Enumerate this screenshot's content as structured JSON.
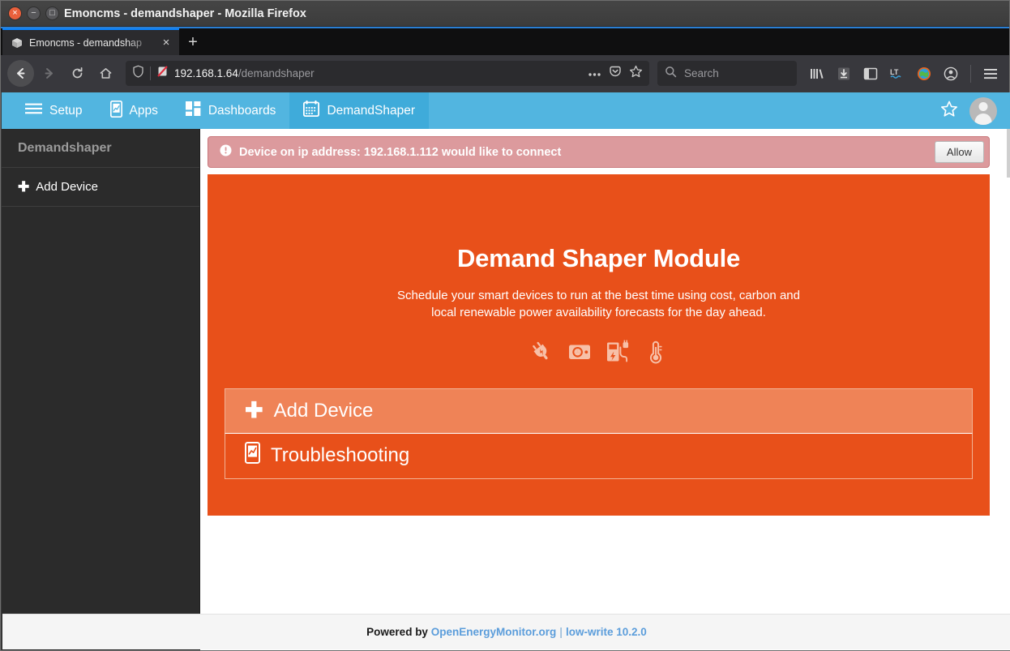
{
  "window": {
    "title": "Emoncms - demandshaper - Mozilla Firefox",
    "close_glyph": "×",
    "minimize_glyph": "−",
    "maximize_glyph": "□"
  },
  "browser": {
    "tab": {
      "title": "Emoncms - demandshap",
      "close_glyph": "×",
      "favicon_name": "box-favicon"
    },
    "new_tab_glyph": "+",
    "back_glyph": "←",
    "forward_glyph": "→",
    "reload_glyph": "↻",
    "home_glyph": "⌂",
    "url": {
      "host": "192.168.1.64",
      "path": "/demandshaper"
    },
    "search": {
      "placeholder": "Search"
    },
    "toolbar_icons": [
      "library-icon",
      "downloads-icon",
      "sidebar-icon",
      "languagetool-icon",
      "globe-extension-icon",
      "account-icon",
      "app-menu-icon"
    ]
  },
  "topnav": {
    "items": [
      {
        "label": "Setup",
        "icon": "hamburger-icon",
        "active": false
      },
      {
        "label": "Apps",
        "icon": "mobile-chart-icon",
        "active": false
      },
      {
        "label": "Dashboards",
        "icon": "grid-icon",
        "active": false
      },
      {
        "label": "DemandShaper",
        "icon": "calendar-icon",
        "active": true
      }
    ],
    "star_glyph": "☆",
    "avatar_name": "user-avatar"
  },
  "sidebar": {
    "header": "Demandshaper",
    "items": [
      {
        "label": "Add Device",
        "icon": "plus-icon",
        "plus": "✚"
      }
    ]
  },
  "alert": {
    "icon": "exclamation-circle-icon",
    "message": "Device on ip address: 192.168.1.112 would like to connect",
    "button_label": "Allow"
  },
  "hero": {
    "title": "Demand Shaper Module",
    "subtitle": "Schedule your smart devices to run at the best time using cost, carbon and local renewable power availability forecasts for the day ahead.",
    "device_icons": [
      "plug-icon",
      "washing-machine-icon",
      "ev-charger-icon",
      "thermostat-icon"
    ],
    "actions": [
      {
        "label": "Add Device",
        "icon": "plus-icon",
        "plus": "✚",
        "hovered": true
      },
      {
        "label": "Troubleshooting",
        "icon": "mobile-chart-icon",
        "hovered": false
      }
    ]
  },
  "footer": {
    "powered_by": "Powered by",
    "link_primary": "OpenEnergyMonitor.org",
    "separator": "|",
    "link_secondary": "low-write 10.2.0"
  },
  "colors": {
    "accent_orange": "#e8501a",
    "accent_orange_light": "#ef8357",
    "nav_blue": "#52b5e0",
    "nav_blue_active": "#3fabda",
    "alert_pink": "#dc9a9d",
    "sidebar_dark": "#2b2b2b",
    "link_blue": "#5b9ddb"
  }
}
